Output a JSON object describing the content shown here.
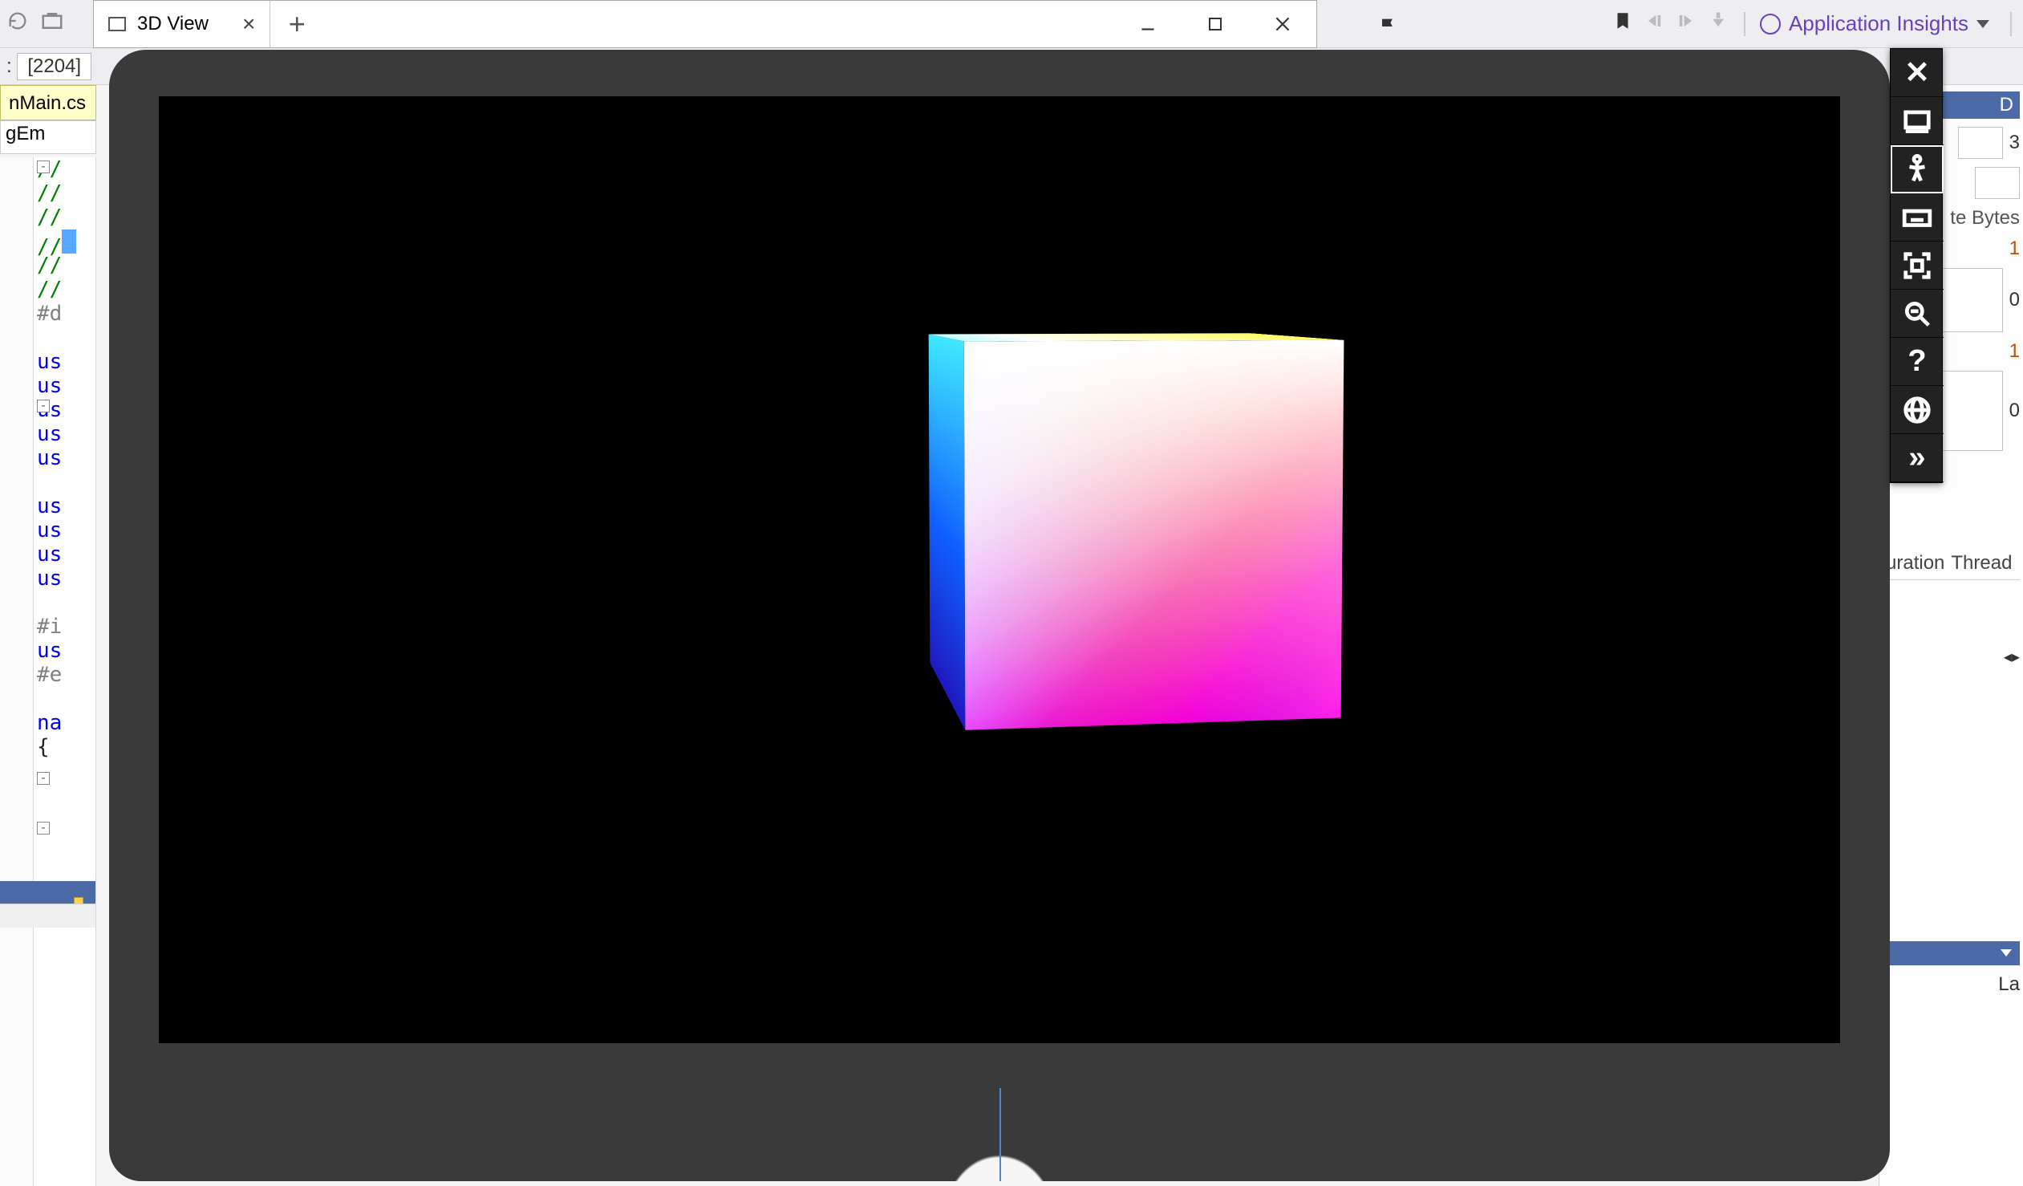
{
  "toolbar": {
    "application_insights_label": "Application Insights",
    "process_label_prefix": ":",
    "process_id": "[2204]"
  },
  "editor": {
    "active_file_tab": "nMain.cs",
    "combo_value": "gEm",
    "code_tokens": {
      "comment_slashes": "//",
      "pound_d": "#d",
      "using_kw": "us",
      "pound_i": "#i",
      "pound_e": "#e",
      "namespace_kw": "na",
      "open_brace": "{"
    }
  },
  "app_window": {
    "tab_title": "3D View"
  },
  "dev_toolbar": {
    "items": [
      {
        "name": "close-icon"
      },
      {
        "name": "desktop-icon"
      },
      {
        "name": "body-tracking-icon"
      },
      {
        "name": "keyboard-icon"
      },
      {
        "name": "fit-to-view-icon"
      },
      {
        "name": "search-zoom-icon"
      },
      {
        "name": "help-icon"
      },
      {
        "name": "web-globe-icon"
      },
      {
        "name": "expand-more-icon"
      }
    ]
  },
  "right_panel": {
    "bytes_label": "te Bytes",
    "col_duration": "uration",
    "col_thread": "Thread",
    "header_last": "La",
    "header_d": "D",
    "value1": "1",
    "value0": "0",
    "value3": "3"
  }
}
